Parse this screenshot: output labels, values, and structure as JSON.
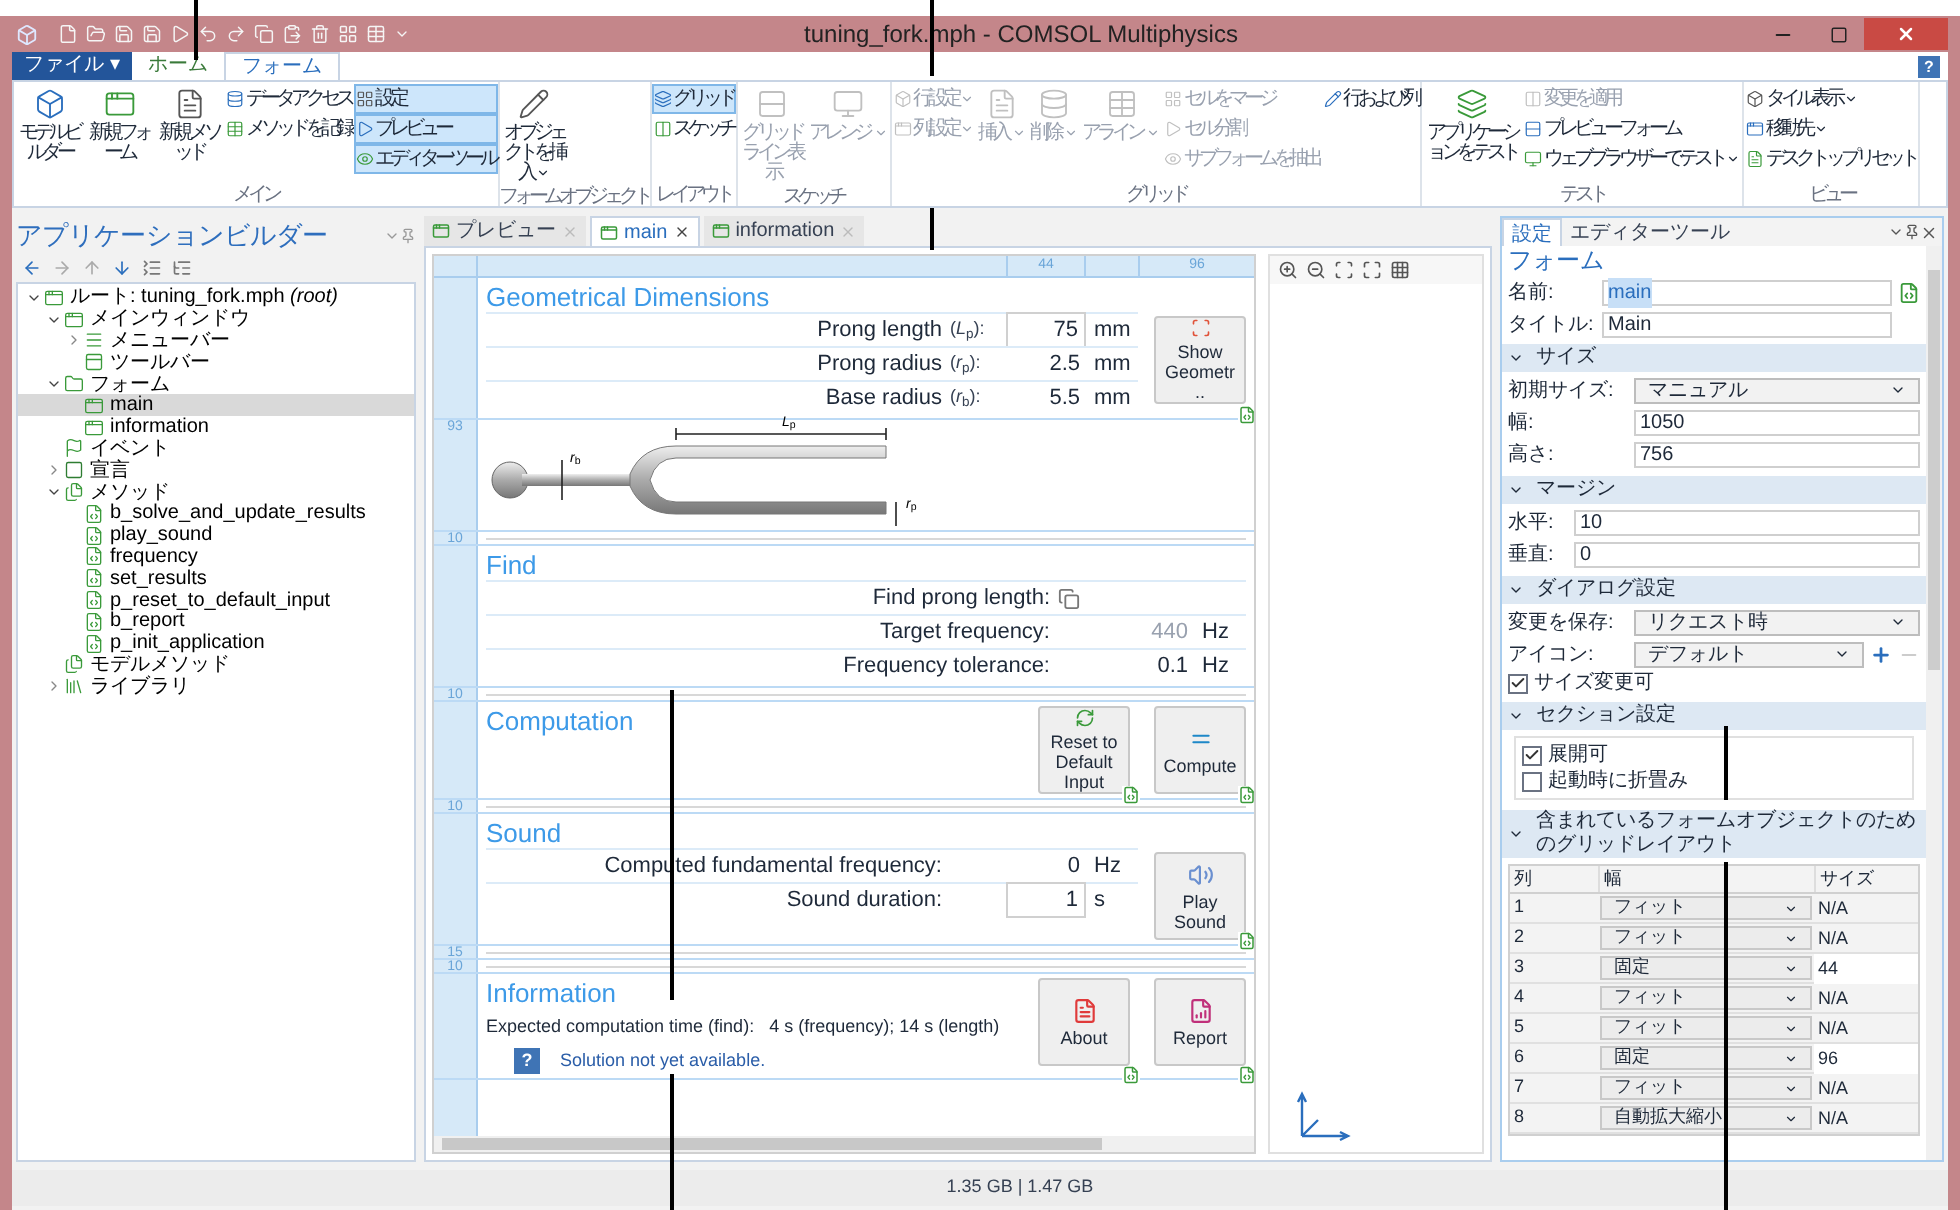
{
  "window": {
    "title": "tuning_fork.mph - COMSOL Multiphysics"
  },
  "file_menu": "ファイル ▾",
  "ribbon_tabs": [
    {
      "label": "ホーム",
      "selected": false
    },
    {
      "label": "フォーム",
      "selected": true
    }
  ],
  "help_button": "?",
  "ribbon_groups": [
    {
      "label": "メイン",
      "columns": [
        [
          {
            "label": "モデルビルダー",
            "kind": "large",
            "disabled": false,
            "selected": false
          }
        ],
        [
          {
            "label": "新規フォーム",
            "kind": "large",
            "disabled": false,
            "selected": false
          }
        ],
        [
          {
            "label": "新規メソッド",
            "kind": "large",
            "disabled": false,
            "selected": false
          }
        ],
        [
          {
            "label": "データアクセス",
            "kind": "small",
            "disabled": false,
            "selected": false
          },
          {
            "label": "メソッドを記録",
            "kind": "small",
            "disabled": false,
            "selected": false
          }
        ],
        [
          {
            "label": "設定",
            "kind": "small",
            "disabled": false,
            "selected": true
          },
          {
            "label": "プレビュー",
            "kind": "small",
            "disabled": false,
            "selected": true
          },
          {
            "label": "エディターツール",
            "kind": "small",
            "disabled": false,
            "selected": true
          }
        ]
      ]
    },
    {
      "label": "フォームオブジェクト",
      "columns": [
        [
          {
            "label": "オブジェクトを挿入",
            "kind": "large",
            "disabled": false,
            "selected": false,
            "caret": true
          }
        ]
      ]
    },
    {
      "label": "レイアウト",
      "columns": [
        [
          {
            "label": "グリッド",
            "kind": "small",
            "disabled": false,
            "selected": true
          },
          {
            "label": "スケッチ",
            "kind": "small",
            "disabled": false,
            "selected": false
          }
        ]
      ]
    },
    {
      "label": "スケッチ",
      "columns": [
        [
          {
            "label": "グリッドライン表示",
            "kind": "large",
            "disabled": true,
            "selected": false
          }
        ],
        [
          {
            "label": "アレンジ",
            "kind": "large",
            "disabled": true,
            "selected": false,
            "caret": true
          }
        ]
      ]
    },
    {
      "label": "グリッド",
      "columns": [
        [
          {
            "label": "行設定",
            "kind": "small",
            "disabled": true,
            "selected": false,
            "caret": true
          },
          {
            "label": "列設定",
            "kind": "small",
            "disabled": true,
            "selected": false,
            "caret": true
          }
        ],
        [
          {
            "label": "挿入",
            "kind": "large",
            "disabled": true,
            "selected": false,
            "caret": true
          }
        ],
        [
          {
            "label": "削除",
            "kind": "large",
            "disabled": true,
            "selected": false,
            "caret": true
          }
        ],
        [
          {
            "label": "アライン",
            "kind": "large",
            "disabled": true,
            "selected": false,
            "caret": true
          }
        ],
        [
          {
            "label": "セルをマージ",
            "kind": "small",
            "disabled": true,
            "selected": false
          },
          {
            "label": "セル分割",
            "kind": "small",
            "disabled": true,
            "selected": false
          },
          {
            "label": "サブフォームを抽出",
            "kind": "small",
            "disabled": true,
            "selected": false
          }
        ],
        [
          {
            "label": "行および列",
            "kind": "small",
            "disabled": false,
            "selected": false
          }
        ]
      ]
    },
    {
      "label": "テスト",
      "columns": [
        [
          {
            "label": "アプリケーションをテスト",
            "kind": "large",
            "disabled": false,
            "selected": false
          }
        ],
        [
          {
            "label": "変更を適用",
            "kind": "small",
            "disabled": true,
            "selected": false
          },
          {
            "label": "プレビューフォーム",
            "kind": "small",
            "disabled": false,
            "selected": false
          },
          {
            "label": "ウェブブラウザーでテスト",
            "kind": "small",
            "disabled": false,
            "selected": false,
            "caret": true
          }
        ]
      ]
    },
    {
      "label": "ビュー",
      "columns": [
        [
          {
            "label": "タイル表示",
            "kind": "small",
            "disabled": false,
            "selected": false,
            "caret": true
          },
          {
            "label": "移動先",
            "kind": "small",
            "disabled": false,
            "selected": false,
            "caret": true
          },
          {
            "label": "デスクトップリセット",
            "kind": "small",
            "disabled": false,
            "selected": false
          }
        ]
      ]
    }
  ],
  "app_builder": {
    "title": "アプリケーションビルダー",
    "tree": [
      {
        "label": "ルート: tuning_fork.mph *(root)*",
        "kind": "root",
        "expanded": true,
        "selected": false,
        "children": [
          {
            "label": "メインウィンドウ",
            "kind": "window",
            "expanded": true,
            "selected": false,
            "children": [
              {
                "label": "メニューバー",
                "kind": "menu",
                "expanded": false,
                "selected": false
              },
              {
                "label": "ツールバー",
                "kind": "toolbar",
                "selected": false
              }
            ]
          },
          {
            "label": "フォーム",
            "kind": "forms",
            "expanded": true,
            "selected": false,
            "children": [
              {
                "label": "main",
                "kind": "form",
                "selected": true
              },
              {
                "label": "information",
                "kind": "form",
                "selected": false
              }
            ]
          },
          {
            "label": "イベント",
            "kind": "event",
            "selected": false
          },
          {
            "label": "宣言",
            "kind": "declare",
            "expanded": false,
            "selected": false
          },
          {
            "label": "メソッド",
            "kind": "methods",
            "expanded": true,
            "selected": false,
            "children": [
              {
                "label": "b_solve_and_update_results",
                "kind": "method",
                "selected": false
              },
              {
                "label": "play_sound",
                "kind": "method",
                "selected": false
              },
              {
                "label": "frequency",
                "kind": "method",
                "selected": false
              },
              {
                "label": "set_results",
                "kind": "method",
                "selected": false
              },
              {
                "label": "p_reset_to_default_input",
                "kind": "method",
                "selected": false
              },
              {
                "label": "b_report",
                "kind": "method",
                "selected": false
              },
              {
                "label": "p_init_application",
                "kind": "method",
                "selected": false
              }
            ]
          },
          {
            "label": "モデルメソッド",
            "kind": "methods",
            "selected": false
          },
          {
            "label": "ライブラリ",
            "kind": "library",
            "expanded": false,
            "selected": false
          }
        ]
      }
    ]
  },
  "form_editor": {
    "tabs": [
      {
        "label": "プレビュー",
        "selected": false
      },
      {
        "label": "main",
        "selected": true
      },
      {
        "label": "information",
        "selected": false
      }
    ],
    "column_ruler": [
      "44",
      "96"
    ],
    "sections": [
      {
        "title": "Geometrical Dimensions",
        "ruler_marks": [
          "10"
        ],
        "rows": [
          {
            "kind": "value",
            "label": "Prong length",
            "symbol": "(*L*$_{p}$):",
            "value": "75",
            "unit": "mm",
            "boxed": true,
            "disabled": false
          },
          {
            "kind": "value",
            "label": "Prong radius",
            "symbol": "(*r*$_{p}$):",
            "value": "2.5",
            "unit": "mm",
            "boxed": false,
            "disabled": false
          },
          {
            "kind": "value",
            "label": "Base radius",
            "symbol": "(*r*$_{b}$):",
            "value": "5.5",
            "unit": "mm",
            "boxed": false,
            "disabled": false
          }
        ],
        "buttons": [
          {
            "label": "Show Geometr ..",
            "kind": "geometry"
          }
        ],
        "figure": {
          "ruler": "93",
          "labels": [
            "*L*$_{p}$",
            "*r*$_{b}$",
            "*r*$_{p}$"
          ]
        }
      },
      {
        "title": "Find",
        "ruler_marks": [
          "10"
        ],
        "rows": [
          {
            "kind": "action",
            "label": "Find prong length:"
          },
          {
            "kind": "value",
            "label": "Target frequency:",
            "value": "440",
            "unit": "Hz",
            "boxed": false,
            "disabled": true
          },
          {
            "kind": "value",
            "label": "Frequency tolerance:",
            "value": "0.1",
            "unit": "Hz",
            "boxed": false,
            "disabled": false
          }
        ]
      },
      {
        "title": "Computation",
        "ruler_marks": [
          "10"
        ],
        "buttons": [
          {
            "label": "Reset to Default Input",
            "kind": "reset"
          },
          {
            "label": "Compute",
            "kind": "compute"
          }
        ]
      },
      {
        "title": "Sound",
        "ruler_marks": [
          "15",
          "10"
        ],
        "rows": [
          {
            "kind": "value",
            "label": "Computed fundamental frequency:",
            "value": "0",
            "unit": "Hz",
            "boxed": false,
            "disabled": false
          },
          {
            "kind": "value",
            "label": "Sound duration:",
            "value": "1",
            "unit": "s",
            "boxed": true,
            "disabled": false
          }
        ],
        "buttons": [
          {
            "label": "Play Sound",
            "kind": "sound"
          }
        ]
      },
      {
        "title": "Information",
        "notes": [
          {
            "kind": "text",
            "text": "Expected computation time (find):   4 s (frequency); 14 s (length)"
          },
          {
            "kind": "status",
            "badge": "?",
            "text": "Solution not yet available."
          }
        ],
        "buttons": [
          {
            "label": "About",
            "kind": "pdf"
          },
          {
            "label": "Report",
            "kind": "report"
          }
        ]
      }
    ]
  },
  "settings": {
    "tabs": [
      {
        "label": "設定",
        "selected": true
      },
      {
        "label": "エディターツール",
        "selected": false
      }
    ],
    "heading": "フォーム",
    "fields": [
      {
        "label": "名前:",
        "value": "main",
        "highlighted": true
      },
      {
        "label": "タイトル:",
        "value": "Main",
        "highlighted": false
      }
    ],
    "sections": [
      {
        "title": "サイズ",
        "expanded": true,
        "rows": [
          {
            "kind": "select",
            "label": "初期サイズ:",
            "value": "マニュアル"
          },
          {
            "kind": "text",
            "label": "幅:",
            "value": "1050"
          },
          {
            "kind": "text",
            "label": "高さ:",
            "value": "756"
          }
        ]
      },
      {
        "title": "マージン",
        "expanded": true,
        "rows": [
          {
            "kind": "text",
            "label": "水平:",
            "value": "10"
          },
          {
            "kind": "text",
            "label": "垂直:",
            "value": "0"
          }
        ]
      },
      {
        "title": "ダイアログ設定",
        "expanded": true,
        "rows": [
          {
            "kind": "select",
            "label": "変更を保存:",
            "value": "リクエスト時"
          },
          {
            "kind": "select_add",
            "label": "アイコン:",
            "value": "デフォルト"
          },
          {
            "kind": "checkbox",
            "label": "サイズ変更可",
            "checked": true
          }
        ]
      },
      {
        "title": "セクション設定",
        "expanded": true,
        "grouped": true,
        "rows": [
          {
            "kind": "checkbox",
            "label": "展開可",
            "checked": true
          },
          {
            "kind": "checkbox",
            "label": "起動時に折畳み",
            "checked": false
          }
        ]
      },
      {
        "title": "含まれているフォームオブジェクトのためのグリッドレイアウト",
        "expanded": true,
        "table": {
          "columns": [
            "列",
            "幅",
            "サイズ"
          ],
          "rows": [
            {
              "index": "1",
              "width": "フィット",
              "size": "N/A",
              "editable": false
            },
            {
              "index": "2",
              "width": "フィット",
              "size": "N/A",
              "editable": false
            },
            {
              "index": "3",
              "width": "固定",
              "size": "44",
              "editable": true
            },
            {
              "index": "4",
              "width": "フィット",
              "size": "N/A",
              "editable": false
            },
            {
              "index": "5",
              "width": "フィット",
              "size": "N/A",
              "editable": false
            },
            {
              "index": "6",
              "width": "固定",
              "size": "96",
              "editable": true
            },
            {
              "index": "7",
              "width": "フィット",
              "size": "N/A",
              "editable": false
            },
            {
              "index": "8",
              "width": "自動拡大縮小",
              "size": "N/A",
              "editable": false
            }
          ]
        }
      }
    ]
  },
  "status_bar": {
    "memory": "1.35 GB | 1.47 GB"
  }
}
